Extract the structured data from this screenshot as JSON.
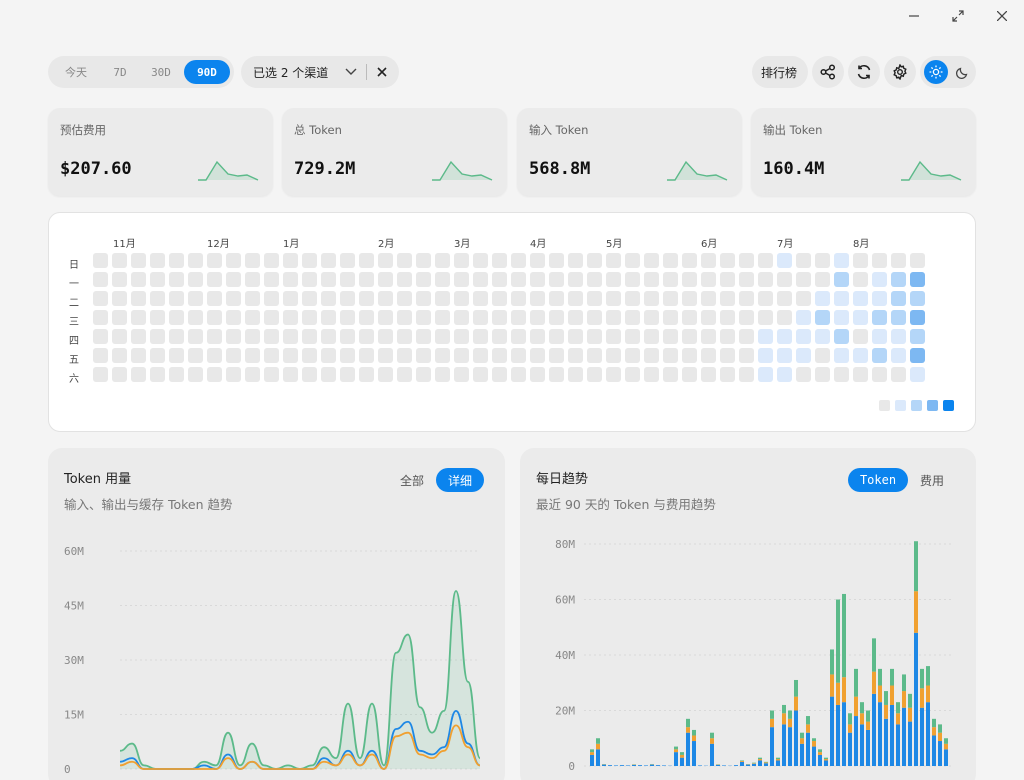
{
  "window": {
    "minimize_icon": "minimize-icon",
    "maximize_icon": "maximize-icon",
    "close_icon": "close-icon"
  },
  "ranges": [
    "今天",
    "7D",
    "30D",
    "90D"
  ],
  "active_range": "90D",
  "channel": {
    "label": "已选 2 个渠道"
  },
  "toolbar": {
    "leaderboard": "排行榜"
  },
  "colors": {
    "accent": "#0b84ee",
    "green": "#5cba8a",
    "orange": "#f0a030",
    "blue": "#1e88e5"
  },
  "stats": [
    {
      "label": "预估费用",
      "value": "$207.60"
    },
    {
      "label": "总 Token",
      "value": "729.2M"
    },
    {
      "label": "输入 Token",
      "value": "568.8M"
    },
    {
      "label": "输出 Token",
      "value": "160.4M"
    }
  ],
  "heatmap": {
    "months": [
      "11月",
      "12月",
      "1月",
      "2月",
      "3月",
      "4月",
      "5月",
      "6月",
      "7月",
      "8月"
    ],
    "weekdays": [
      "日",
      "一",
      "二",
      "三",
      "四",
      "五",
      "六"
    ]
  },
  "usage_panel": {
    "title": "Token 用量",
    "subtitle": "输入、输出与缓存 Token 趋势",
    "toggle_all": "全部",
    "toggle_detail": "详细",
    "yticks": [
      "60M",
      "45M",
      "30M",
      "15M",
      "0"
    ]
  },
  "trend_panel": {
    "title": "每日趋势",
    "subtitle": "最近 90 天的 Token 与费用趋势",
    "toggle_token": "Token",
    "toggle_cost": "费用",
    "yticks": [
      "80M",
      "60M",
      "40M",
      "20M",
      "0"
    ]
  },
  "chart_data": [
    {
      "type": "line",
      "ylim": [
        0,
        60
      ],
      "series": [
        {
          "values": [
            5,
            7,
            1,
            0,
            0,
            0,
            0,
            2,
            1,
            10,
            1,
            7,
            1,
            0,
            1,
            0,
            1,
            6,
            3,
            18,
            3,
            18,
            1,
            32,
            37,
            17,
            10,
            16,
            49,
            24,
            3
          ]
        },
        {
          "values": [
            2,
            3,
            0,
            0,
            0,
            0,
            0,
            1,
            0,
            4,
            0,
            2,
            0,
            0,
            0,
            0,
            0,
            3,
            1,
            5,
            1,
            5,
            0,
            11,
            13,
            5,
            4,
            6,
            16,
            7,
            1
          ]
        },
        {
          "values": [
            1,
            2,
            0,
            0,
            0,
            0,
            0,
            0,
            0,
            3,
            0,
            2,
            0,
            0,
            0,
            0,
            0,
            2,
            1,
            4,
            1,
            4,
            0,
            9,
            10,
            4,
            3,
            5,
            12,
            6,
            1
          ]
        }
      ]
    },
    {
      "type": "bar",
      "ylim": [
        0,
        80
      ],
      "series": [
        {
          "values": [
            4,
            6,
            0.5,
            0.3,
            0.2,
            0.3,
            0.2,
            0.4,
            0.3,
            0.2,
            0.5,
            0.3,
            0.2,
            0.1,
            5,
            3,
            12,
            9,
            0.2,
            0.1,
            8,
            0.4,
            0.2,
            0.1,
            0.3,
            1.5,
            0.5,
            0.8,
            2,
            1,
            14,
            2,
            15,
            14,
            20,
            8,
            12,
            7,
            4,
            2,
            25,
            22,
            23,
            12,
            18,
            15,
            13,
            26,
            23,
            17,
            22,
            15,
            21,
            16,
            48,
            21,
            23,
            11,
            9,
            6
          ]
        },
        {
          "values": [
            1,
            2,
            0.1,
            0,
            0,
            0,
            0,
            0.1,
            0,
            0,
            0.1,
            0,
            0,
            0,
            1,
            1,
            2,
            2,
            0,
            0,
            2,
            0.1,
            0,
            0,
            0,
            0.3,
            0.1,
            0.2,
            0.5,
            0.3,
            3,
            0.5,
            4,
            3,
            5,
            2,
            3,
            2,
            1,
            0.5,
            8,
            8,
            9,
            3,
            7,
            4,
            3,
            8,
            6,
            5,
            7,
            4,
            6,
            5,
            15,
            7,
            6,
            3,
            3,
            2
          ]
        },
        {
          "values": [
            1,
            2,
            0.1,
            0,
            0,
            0,
            0,
            0.1,
            0,
            0,
            0.1,
            0,
            0,
            0,
            1,
            1,
            3,
            2,
            0,
            0,
            2,
            0.1,
            0,
            0,
            0,
            0.2,
            0.1,
            0.2,
            0.5,
            0.2,
            3,
            0.5,
            3,
            3,
            6,
            2,
            3,
            1,
            1,
            0.5,
            9,
            30,
            30,
            4,
            10,
            4,
            4,
            12,
            6,
            5,
            6,
            4,
            6,
            5,
            18,
            7,
            7,
            3,
            3,
            2
          ]
        }
      ]
    }
  ]
}
